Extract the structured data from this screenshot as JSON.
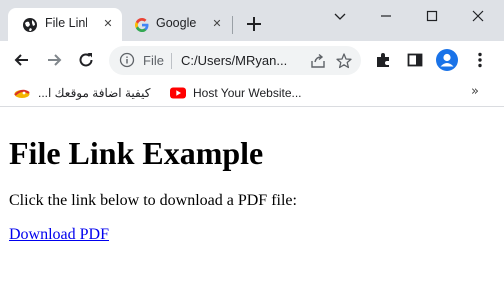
{
  "tabs": [
    {
      "title": "File Link",
      "icon": "globe-icon",
      "active": true
    },
    {
      "title": "Google",
      "icon": "google-icon",
      "active": false
    }
  ],
  "toolbar": {
    "scheme_label": "File",
    "url": "C:/Users/MRyan..."
  },
  "bookmarks": [
    {
      "label": "كيفية اضافة موقعك ا...",
      "icon": "bookmark-favicon-icon"
    },
    {
      "label": "Host Your Website...",
      "icon": "youtube-icon"
    }
  ],
  "page": {
    "title": "File Link Example",
    "paragraph": "Click the link below to download a PDF file:",
    "link": "Download PDF"
  },
  "colors": {
    "tabstrip": "#dee1e6",
    "link": "#0000ee",
    "avatar": "#1a73e8",
    "youtube": "#ff0000"
  }
}
